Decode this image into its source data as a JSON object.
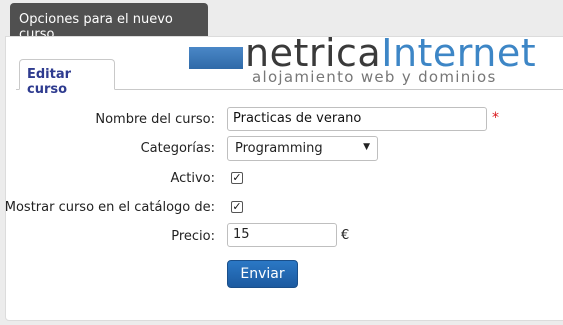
{
  "window": {
    "title": "Opciones para el nuevo curso"
  },
  "tabs": {
    "active_label": "Editar curso"
  },
  "logo": {
    "name_part1": "netrica",
    "name_part2": "Internet",
    "tagline": "alojamiento web y dominios"
  },
  "form": {
    "course_name_label": "Nombre del curso:",
    "course_name_value": "Practicas de verano",
    "required_marker": "*",
    "category_label": "Categorías:",
    "category_selected": "Programming",
    "active_label": "Activo:",
    "active_checked": true,
    "catalog_label": "Mostrar curso en el catálogo de:",
    "catalog_checked": true,
    "price_label": "Precio:",
    "price_value": "15",
    "currency_symbol": "€",
    "submit_label": "Enviar"
  },
  "icons": {
    "select_caret": "caret-down-icon",
    "checkbox_mark": "checkmark-icon"
  },
  "colors": {
    "header": "#505050",
    "tab_text": "#2e3b8f",
    "button": "#2b78c5",
    "required": "#d9161a",
    "logo_accent": "#3d86c6"
  }
}
